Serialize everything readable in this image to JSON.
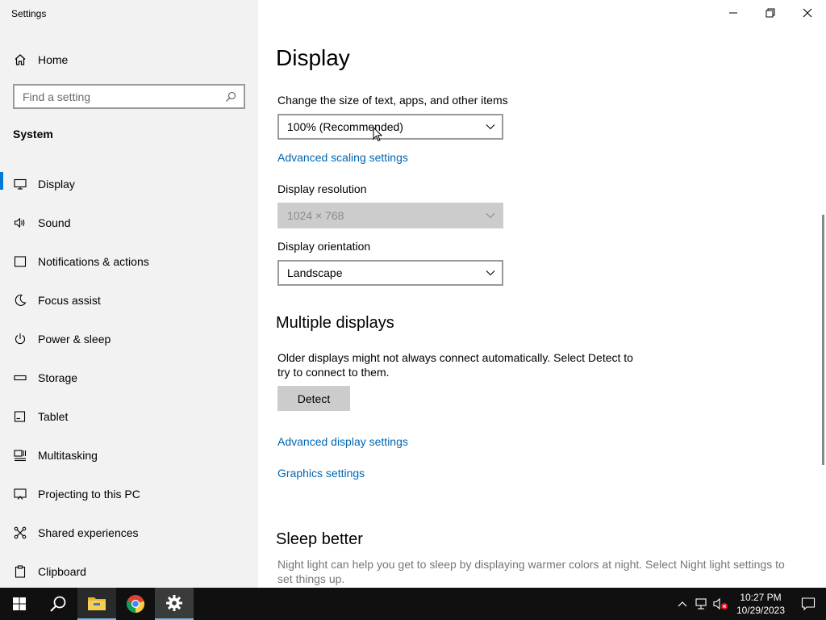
{
  "window": {
    "title": "Settings"
  },
  "sidebar": {
    "home_label": "Home",
    "search_placeholder": "Find a setting",
    "section_title": "System",
    "items": [
      {
        "label": "Display",
        "icon": "monitor-icon",
        "active": true
      },
      {
        "label": "Sound",
        "icon": "speaker-icon"
      },
      {
        "label": "Notifications & actions",
        "icon": "notification-icon"
      },
      {
        "label": "Focus assist",
        "icon": "moon-icon"
      },
      {
        "label": "Power & sleep",
        "icon": "power-icon"
      },
      {
        "label": "Storage",
        "icon": "storage-icon"
      },
      {
        "label": "Tablet",
        "icon": "tablet-icon"
      },
      {
        "label": "Multitasking",
        "icon": "multitasking-icon"
      },
      {
        "label": "Projecting to this PC",
        "icon": "projecting-icon"
      },
      {
        "label": "Shared experiences",
        "icon": "shared-icon"
      },
      {
        "label": "Clipboard",
        "icon": "clipboard-icon"
      }
    ]
  },
  "main": {
    "title": "Display",
    "scale_label": "Change the size of text, apps, and other items",
    "scale_value": "100% (Recommended)",
    "advanced_scaling_link": "Advanced scaling settings",
    "resolution_label": "Display resolution",
    "resolution_value": "1024 × 768",
    "orientation_label": "Display orientation",
    "orientation_value": "Landscape",
    "multiple_displays_title": "Multiple displays",
    "multiple_displays_line1": "Older displays might not always connect automatically. Select Detect to",
    "multiple_displays_line2": "try to connect to them.",
    "detect_button": "Detect",
    "advanced_display_link": "Advanced display settings",
    "graphics_link": "Graphics settings",
    "sleep_title": "Sleep better",
    "sleep_line1": "Night light can help you get to sleep by displaying warmer colors at night. Select Night light settings to",
    "sleep_line2": "set things up."
  },
  "taskbar": {
    "time": "10:27 PM",
    "date": "10/29/2023",
    "apps": [
      "start-icon",
      "search-icon",
      "file-explorer-icon",
      "chrome-icon",
      "settings-icon"
    ]
  },
  "colors": {
    "accent": "#0078d7",
    "link": "#0066b4",
    "sidebar_bg": "#f2f2f2",
    "taskbar_bg": "#101010"
  }
}
